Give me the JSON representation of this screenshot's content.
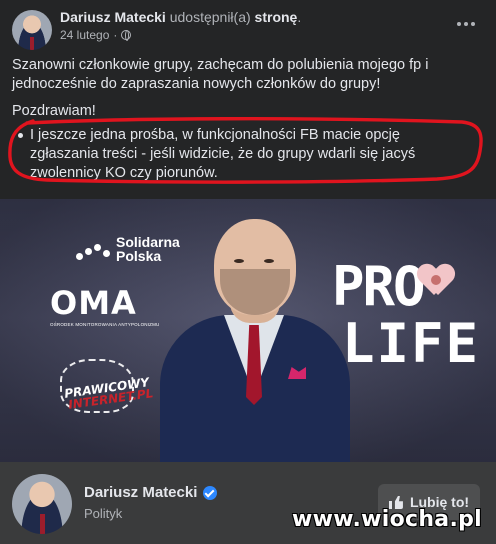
{
  "post": {
    "author": "Dariusz Matecki",
    "shared_text": "udostępnił(a)",
    "shared_object": "stronę",
    "shared_suffix": ".",
    "date": "24 lutego",
    "separator": "·",
    "paragraphs": [
      "Szanowni członkowie grupy, zachęcam do polubienia mojego fp i jednocześnie do zapraszania nowych członków do grupy!",
      "Pozdrawiam!"
    ],
    "bullets": [
      "I jeszcze jedna prośba, w funkcjonalności FB macie opcję zgłaszania treści - jeśli widzicie, że do grupy wdarli się jacyś zwolennicy KO czy piorunów."
    ],
    "highlight_color": "#e0141e"
  },
  "image": {
    "logo_solidarna": "Solidarna",
    "logo_polska": "Polska",
    "logo_oma": "OMA",
    "logo_oma_sub": "OŚRODEK MONITOROWANIA ANTYPOLONIZMU",
    "logo_prawicowy_1": "PRAWICOWY",
    "logo_prawicowy_2": "INTERNET.PL",
    "pro_life_1": "PRO",
    "pro_life_2": "LIFE"
  },
  "page_card": {
    "name": "Dariusz Matecki",
    "category": "Polityk",
    "like_label": "Lubię to!"
  },
  "watermark": "www.wiocha.pl",
  "colors": {
    "background": "#242526",
    "card": "#3a3b3c",
    "text": "#e4e6eb",
    "muted": "#b0b3b8",
    "verified": "#2d88ff"
  }
}
